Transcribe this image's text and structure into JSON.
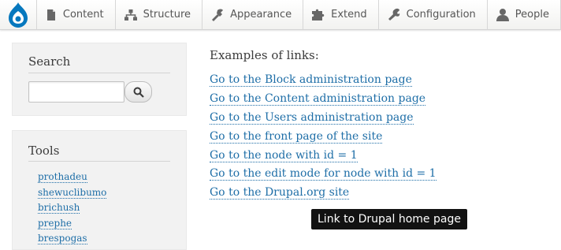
{
  "toolbar": {
    "logo_icon": "drupal-drop-icon",
    "brand_color": "#0678be",
    "items": [
      {
        "label": "Content",
        "icon": "document-icon"
      },
      {
        "label": "Structure",
        "icon": "hierarchy-icon"
      },
      {
        "label": "Appearance",
        "icon": "wrench-brush-icon"
      },
      {
        "label": "Extend",
        "icon": "puzzle-icon"
      },
      {
        "label": "Configuration",
        "icon": "wrench-icon"
      },
      {
        "label": "People",
        "icon": "person-icon"
      }
    ]
  },
  "sidebar": {
    "search": {
      "title": "Search",
      "input_value": "",
      "button_icon": "magnifier-icon"
    },
    "tools": {
      "title": "Tools",
      "items": [
        "prothadeu",
        "shewuclibumo",
        "brichush",
        "prephe",
        "brespogas"
      ]
    }
  },
  "main": {
    "intro": "Examples of links:",
    "links": [
      "Go to the Block administration page",
      "Go to the Content administration page",
      "Go to the Users administration page",
      "Go to the front page of the site",
      "Go to the node with id = 1",
      "Go to the edit mode for node with id = 1",
      "Go to the Drupal.org site"
    ]
  },
  "tooltip": {
    "text": "Link to Drupal home page"
  },
  "colors": {
    "link": "#1e6ea7",
    "sidebar_bg": "#f2f2f2",
    "tooltip_bg": "#121212"
  }
}
